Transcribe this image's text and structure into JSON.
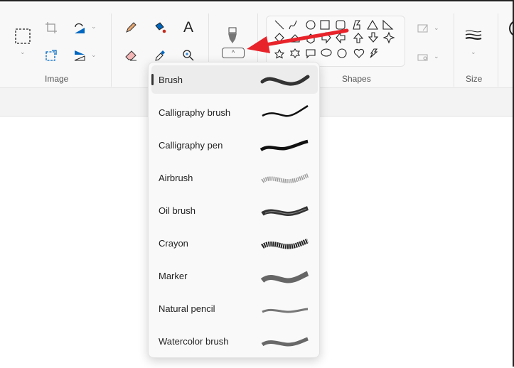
{
  "ribbon": {
    "groups": [
      {
        "label": "Image"
      },
      {
        "label": "Shapes"
      },
      {
        "label": "Size"
      }
    ],
    "expand_label": "^"
  },
  "brush_menu": {
    "selected": "Brush",
    "items": [
      {
        "label": "Brush",
        "style": "solid"
      },
      {
        "label": "Calligraphy brush",
        "style": "calligraphy"
      },
      {
        "label": "Calligraphy pen",
        "style": "pen"
      },
      {
        "label": "Airbrush",
        "style": "airbrush"
      },
      {
        "label": "Oil brush",
        "style": "oil"
      },
      {
        "label": "Crayon",
        "style": "crayon"
      },
      {
        "label": "Marker",
        "style": "marker"
      },
      {
        "label": "Natural pencil",
        "style": "pencil"
      },
      {
        "label": "Watercolor brush",
        "style": "watercolor"
      }
    ]
  },
  "annotation": {
    "arrow_color": "#e8232a"
  },
  "colors": {
    "accent": "#0067c0"
  }
}
